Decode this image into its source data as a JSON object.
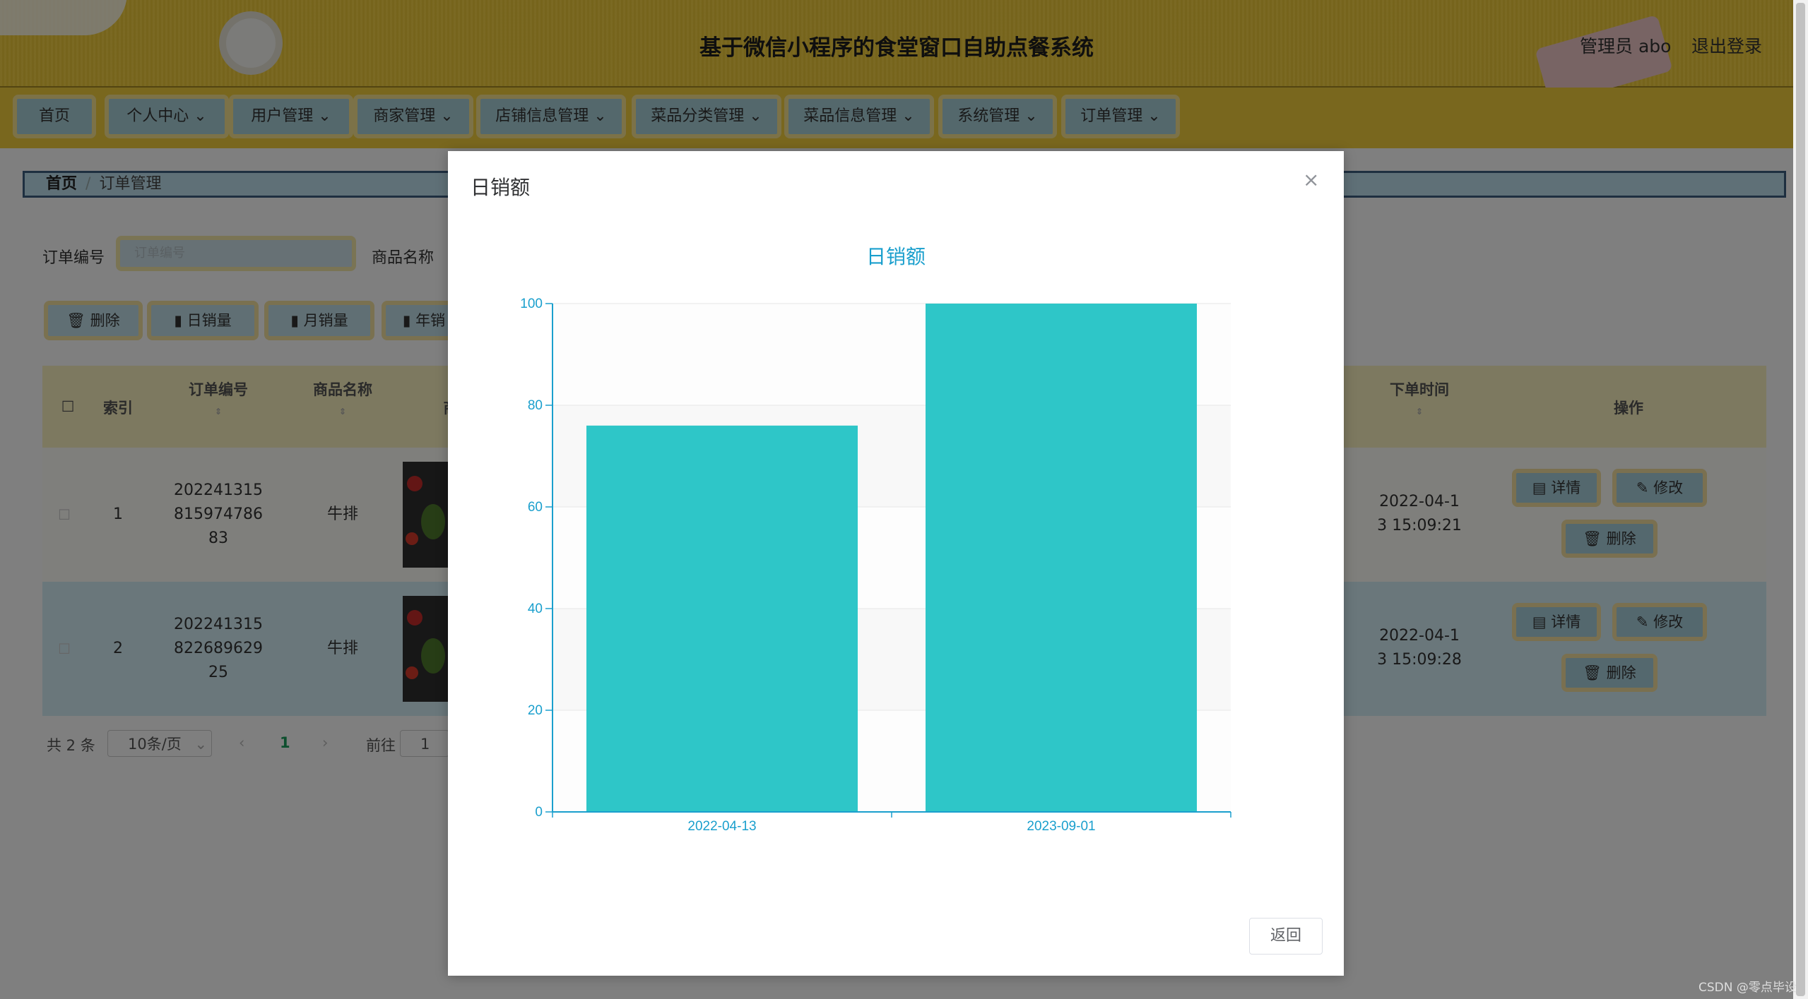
{
  "header": {
    "title": "基于微信小程序的食堂窗口自助点餐系统",
    "user": "管理员 abo",
    "logout": "退出登录"
  },
  "nav": {
    "items": [
      {
        "label": "首页"
      },
      {
        "label": "个人中心"
      },
      {
        "label": "用户管理"
      },
      {
        "label": "商家管理"
      },
      {
        "label": "店铺信息管理"
      },
      {
        "label": "菜品分类管理"
      },
      {
        "label": "菜品信息管理"
      },
      {
        "label": "系统管理"
      },
      {
        "label": "订单管理"
      }
    ]
  },
  "breadcrumb": {
    "home": "首页",
    "sep": "/",
    "current": "订单管理"
  },
  "search": {
    "order_no_label": "订单编号",
    "order_no_placeholder": "订单编号",
    "product_label": "商品名称"
  },
  "actions": {
    "delete": "删除",
    "daily": "日销量",
    "monthly": "月销量",
    "yearly": "年销"
  },
  "table": {
    "columns": {
      "index": "索引",
      "order_no": "订单编号",
      "product": "商品名称",
      "image": "商品图",
      "order_time": "下单时间",
      "ops": "操作"
    },
    "rows": [
      {
        "index": "1",
        "order_no": [
          "202241315",
          "815974786",
          "83"
        ],
        "product": "牛排",
        "time": [
          "2022-04-1",
          "3 15:09:21"
        ]
      },
      {
        "index": "2",
        "order_no": [
          "202241315",
          "822689629",
          "25"
        ],
        "product": "牛排",
        "time": [
          "2022-04-1",
          "3 15:09:28"
        ]
      }
    ],
    "btn_detail": "详情",
    "btn_edit": "修改",
    "btn_delete": "删除"
  },
  "pager": {
    "total": "共 2 条",
    "page_size": "10条/页",
    "current": "1",
    "goto": "前往",
    "goto_value": "1"
  },
  "dialog": {
    "title": "日销额",
    "close": "×",
    "return": "返回"
  },
  "chart_data": {
    "type": "bar",
    "title": "日销额",
    "categories": [
      "2022-04-13",
      "2023-09-01"
    ],
    "values": [
      76,
      100
    ],
    "ylim": [
      0,
      100
    ],
    "yticks": [
      0,
      20,
      40,
      60,
      80,
      100
    ],
    "xlabel": "",
    "ylabel": "",
    "bar_color": "#2ec6c8",
    "axis_color": "#1a9fcd"
  },
  "watermark": "CSDN @零点毕设"
}
